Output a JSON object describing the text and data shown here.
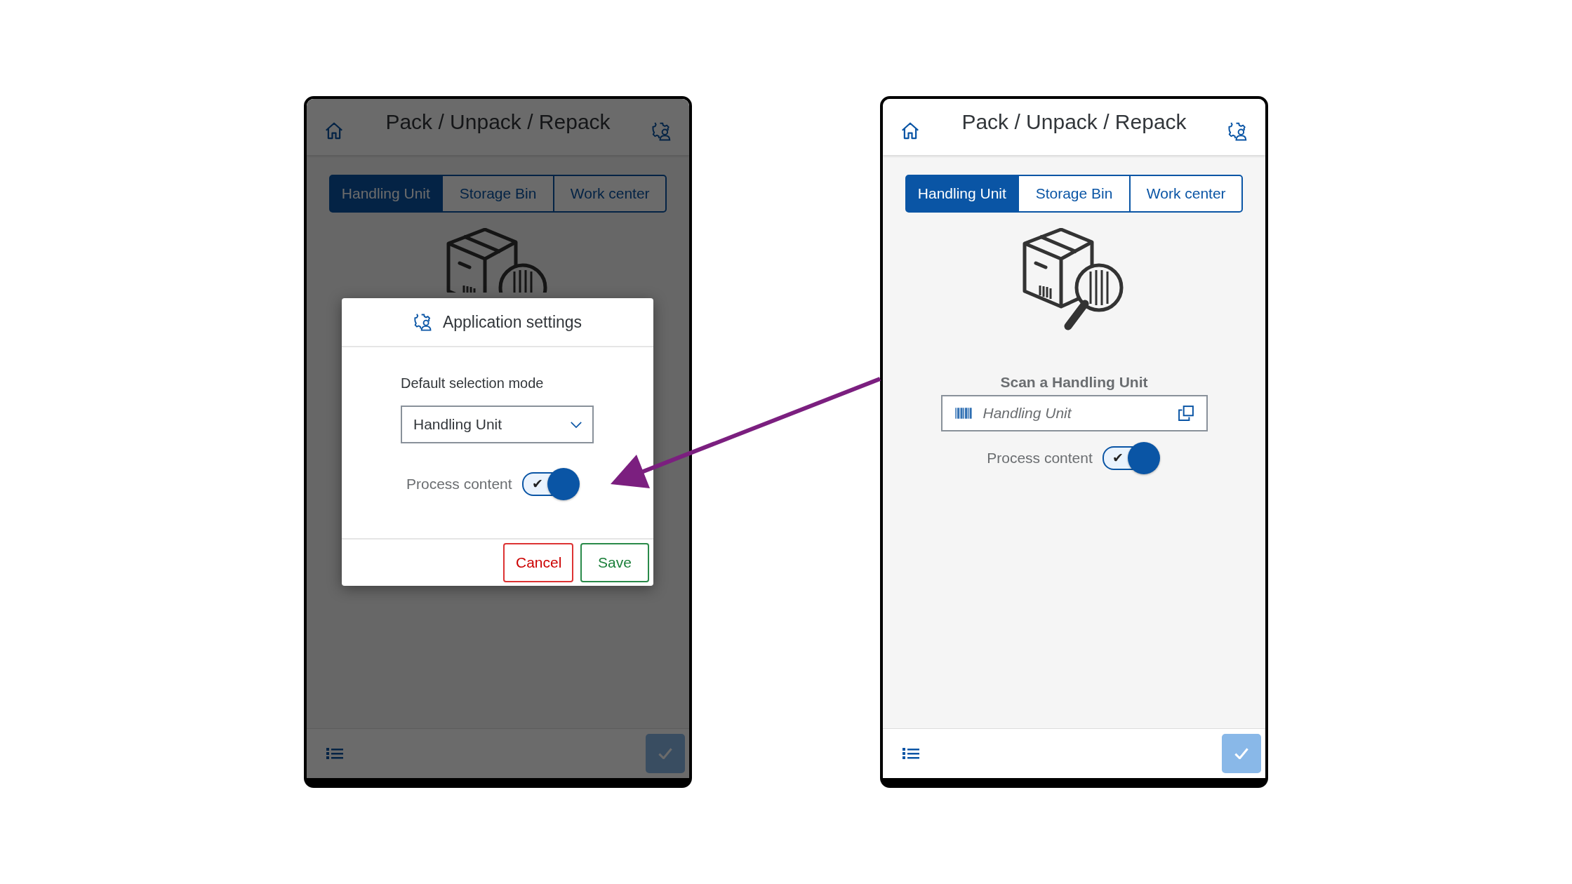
{
  "left_screen": {
    "header": {
      "title": "Pack / Unpack / Repack"
    },
    "tabs": [
      {
        "label": "Handling Unit",
        "selected": true
      },
      {
        "label": "Storage Bin",
        "selected": false
      },
      {
        "label": "Work center",
        "selected": false
      }
    ],
    "dimmed": true,
    "dialog": {
      "title": "Application settings",
      "field_label": "Default selection mode",
      "select_value": "Handling Unit",
      "toggle": {
        "label": "Process content",
        "on": true,
        "check": "✔"
      },
      "buttons": [
        {
          "label": "Cancel",
          "kind": "reject"
        },
        {
          "label": "Save",
          "kind": "accept"
        }
      ]
    }
  },
  "right_screen": {
    "header": {
      "title": "Pack / Unpack / Repack"
    },
    "tabs": [
      {
        "label": "Handling Unit",
        "selected": true
      },
      {
        "label": "Storage Bin",
        "selected": false
      },
      {
        "label": "Work center",
        "selected": false
      }
    ],
    "scan": {
      "label": "Scan a Handling Unit",
      "placeholder": "Handling Unit"
    },
    "toggle": {
      "label": "Process content",
      "on": true,
      "check": "✔"
    }
  }
}
